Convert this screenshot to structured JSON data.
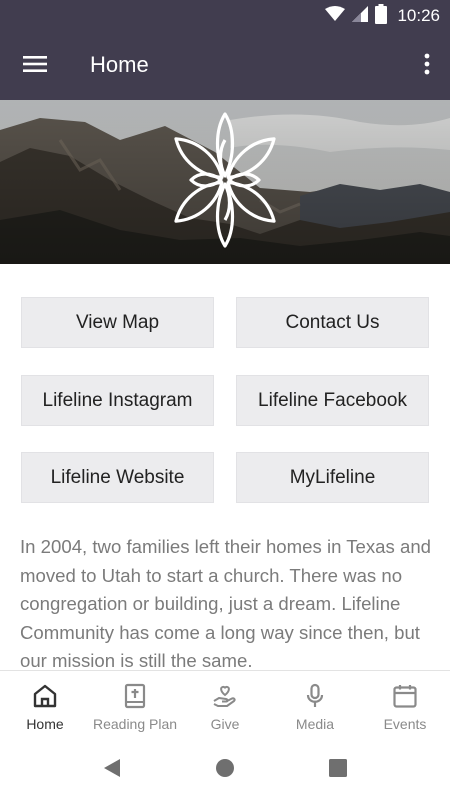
{
  "status_bar": {
    "time": "10:26",
    "icons": [
      "wifi-icon",
      "signal-icon",
      "battery-icon"
    ]
  },
  "app_bar": {
    "title": "Home",
    "menu_icon": "hamburger-menu-icon",
    "more_icon": "more-vert-icon"
  },
  "hero": {
    "logo": "lotus-flower-logo",
    "background": "mountain-landscape"
  },
  "buttons": [
    {
      "label": "View Map"
    },
    {
      "label": "Contact Us"
    },
    {
      "label": "Lifeline Instagram"
    },
    {
      "label": "Lifeline Facebook"
    },
    {
      "label": "Lifeline Website"
    },
    {
      "label": "MyLifeline"
    }
  ],
  "intro_text": "In 2004, two families left their homes in Texas and moved to Utah to start a church. There was no congregation or building, just a dream. Lifeline Community has come a long way since then, but our mission is still the same.",
  "bottom_nav": [
    {
      "label": "Home",
      "icon": "home-icon",
      "active": true
    },
    {
      "label": "Reading Plan",
      "icon": "bible-icon",
      "active": false
    },
    {
      "label": "Give",
      "icon": "give-hand-heart-icon",
      "active": false
    },
    {
      "label": "Media",
      "icon": "microphone-icon",
      "active": false
    },
    {
      "label": "Events",
      "icon": "calendar-icon",
      "active": false
    }
  ],
  "colors": {
    "app_bar": "#413d4f",
    "button_bg": "#ececee",
    "body_text": "#7b7b7b",
    "active_nav": "#333333",
    "inactive_nav": "#8a8a8a"
  }
}
